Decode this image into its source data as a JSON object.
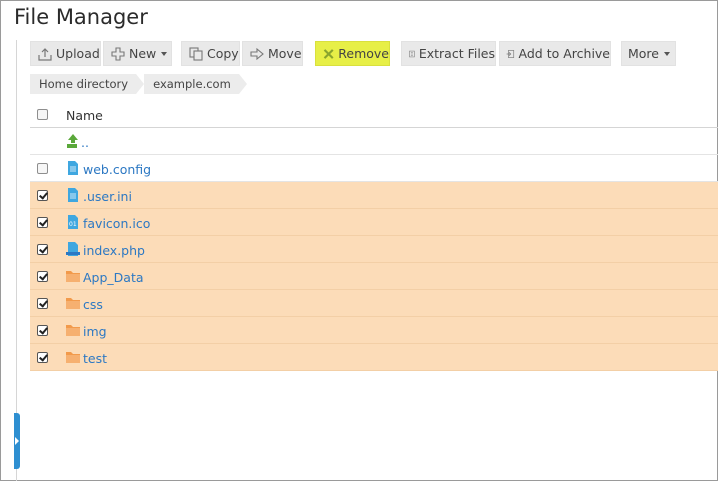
{
  "app": {
    "title": "File Manager"
  },
  "toolbar": {
    "upload": "Upload",
    "new": "New",
    "copy": "Copy",
    "move": "Move",
    "remove": "Remove",
    "extract": "Extract Files",
    "archive": "Add to Archive",
    "more": "More"
  },
  "breadcrumb": [
    "Home directory",
    "example.com"
  ],
  "table": {
    "header": "Name",
    "rows": [
      {
        "name": "..",
        "type": "up-folder",
        "checked": false,
        "selectable": false
      },
      {
        "name": "web.config",
        "type": "file",
        "checked": false
      },
      {
        "name": ".user.ini",
        "type": "file",
        "checked": true
      },
      {
        "name": "favicon.ico",
        "type": "binary-file",
        "checked": true
      },
      {
        "name": "index.php",
        "type": "php-file",
        "checked": true
      },
      {
        "name": "App_Data",
        "type": "folder",
        "checked": true
      },
      {
        "name": "css",
        "type": "folder",
        "checked": true
      },
      {
        "name": "img",
        "type": "folder",
        "checked": true
      },
      {
        "name": "test",
        "type": "folder",
        "checked": true
      }
    ]
  },
  "colors": {
    "selected_row": "#fcdcb8",
    "highlight": "#e7ef47",
    "link": "#2c78c3",
    "folder": "#f29a4b",
    "file": "#3fa7e0"
  }
}
